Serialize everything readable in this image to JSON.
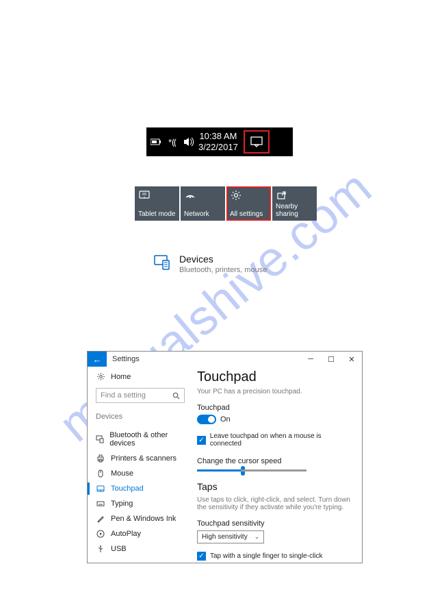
{
  "watermark": "manualshive.com",
  "systray": {
    "time": "10:38 AM",
    "date": "3/22/2017"
  },
  "quick_actions": [
    {
      "label": "Tablet mode",
      "highlighted": false
    },
    {
      "label": "Network",
      "highlighted": false
    },
    {
      "label": "All settings",
      "highlighted": true
    },
    {
      "label": "Nearby sharing",
      "highlighted": false
    }
  ],
  "devices_category": {
    "title": "Devices",
    "subtitle": "Bluetooth, printers, mouse"
  },
  "settings_window": {
    "title": "Settings",
    "home": "Home",
    "search_placeholder": "Find a setting",
    "group": "Devices",
    "nav": [
      "Bluetooth & other devices",
      "Printers & scanners",
      "Mouse",
      "Touchpad",
      "Typing",
      "Pen & Windows Ink",
      "AutoPlay",
      "USB"
    ],
    "active_index": 3,
    "content": {
      "heading": "Touchpad",
      "precision_hint": "Your PC has a precision touchpad.",
      "toggle_label": "Touchpad",
      "toggle_state": "On",
      "leave_on_label": "Leave touchpad on when a mouse is connected",
      "cursor_speed_label": "Change the cursor speed",
      "taps_heading": "Taps",
      "taps_hint": "Use taps to click, right-click, and select. Turn down the sensitivity if they activate while you're typing.",
      "sensitivity_label": "Touchpad sensitivity",
      "sensitivity_value": "High sensitivity",
      "single_tap_label": "Tap with a single finger to single-click"
    }
  }
}
